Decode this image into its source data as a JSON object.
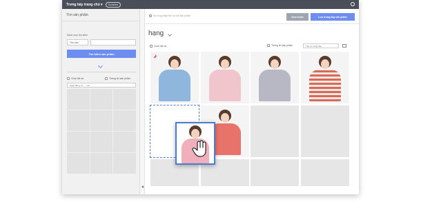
{
  "topbar": {
    "title": "Trưng bày trang chủ ▾",
    "guide_label": "Guideline"
  },
  "sidebar": {
    "heading": "Tìm sản phẩm",
    "category_label": "Danh mục tìm kiếm",
    "category_select": "Tên sản",
    "search_button": "Tìm kiếm sản phẩm",
    "check_all": "Chọn tất cả",
    "product_info": "Thông tin sản phẩm",
    "sort_label": "Ngày đăng: cũ → mới"
  },
  "main": {
    "search_placeholder": "Vui lòng nhập tên và mã sản phẩm",
    "preview_button": "Xem trước",
    "save_button": "Lưu trưng bày sản phẩm",
    "section_title": "hạng",
    "check_all": "Chọn tất cả",
    "product_info": "Thông tin sản phẩm",
    "sort_select": "Thứ tự trưng bày"
  },
  "colors": {
    "accent": "#6d8ef0",
    "topbar": "#4a4e58",
    "drag_border": "#4a7bd0",
    "sweater_blue": "#8fb6dc",
    "sweater_pink": "#f0b0bb",
    "shirt_gray": "#b8b8c4",
    "stripe_red": "#d66a5a"
  },
  "icons": [
    "settings-gear-icon",
    "search-icon",
    "chevron-down-icon",
    "pin-icon",
    "grab-hand-cursor-icon",
    "grid-view-icon",
    "collapse-arrow-icon"
  ]
}
